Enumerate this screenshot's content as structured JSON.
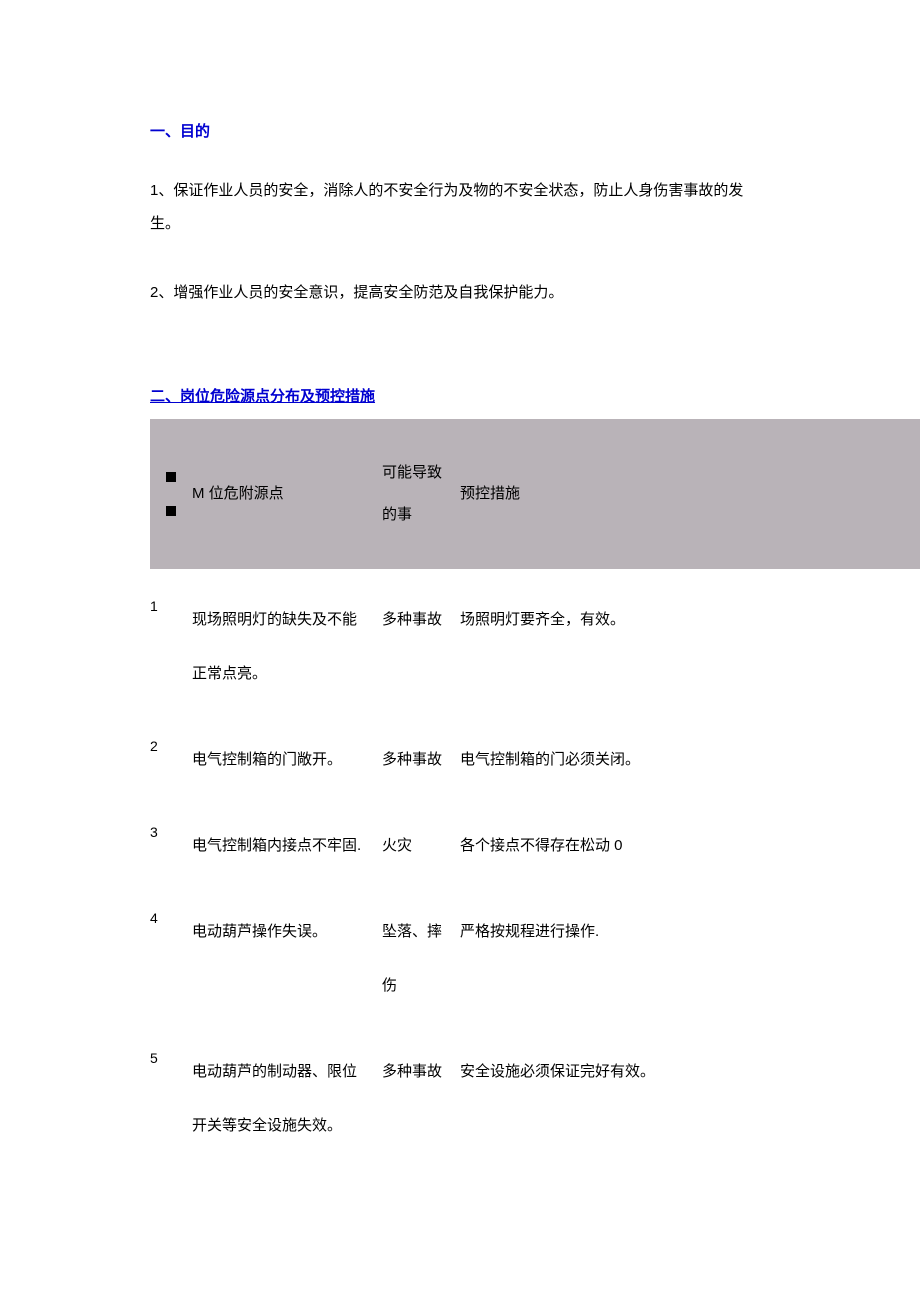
{
  "section1": {
    "heading": "一、目的",
    "para1": "1、保证作业人员的安全，消除人的不安全行为及物的不安全状态，防止人身伤害事故的发生。",
    "para2": "2、增强作业人员的安全意识，提高安全防范及自我保护能力。"
  },
  "section2": {
    "heading": "二、岗位危险源点分布及预控措施",
    "table": {
      "headers": {
        "source": "M 位危附源点",
        "event": "可能导致的事",
        "measure": "预控措施"
      },
      "rows": [
        {
          "num": "1",
          "source": "现场照明灯的缺失及不能正常点亮。",
          "event": "多种事故",
          "measure": "场照明灯要齐全，有效。"
        },
        {
          "num": "2",
          "source": "电气控制箱的门敞开。",
          "event": "多种事故",
          "measure": "电气控制箱的门必须关闭。"
        },
        {
          "num": "3",
          "source": "电气控制箱内接点不牢固.",
          "event": "火灾",
          "measure": "各个接点不得存在松动 0"
        },
        {
          "num": "4",
          "source": "电动葫芦操作失误。",
          "event": "坠落、摔伤",
          "measure": "严格按规程进行操作."
        },
        {
          "num": "5",
          "source": "电动葫芦的制动器、限位开关等安全设施失效。",
          "event": "多种事故",
          "measure": "安全设施必须保证完好有效。"
        }
      ]
    }
  }
}
